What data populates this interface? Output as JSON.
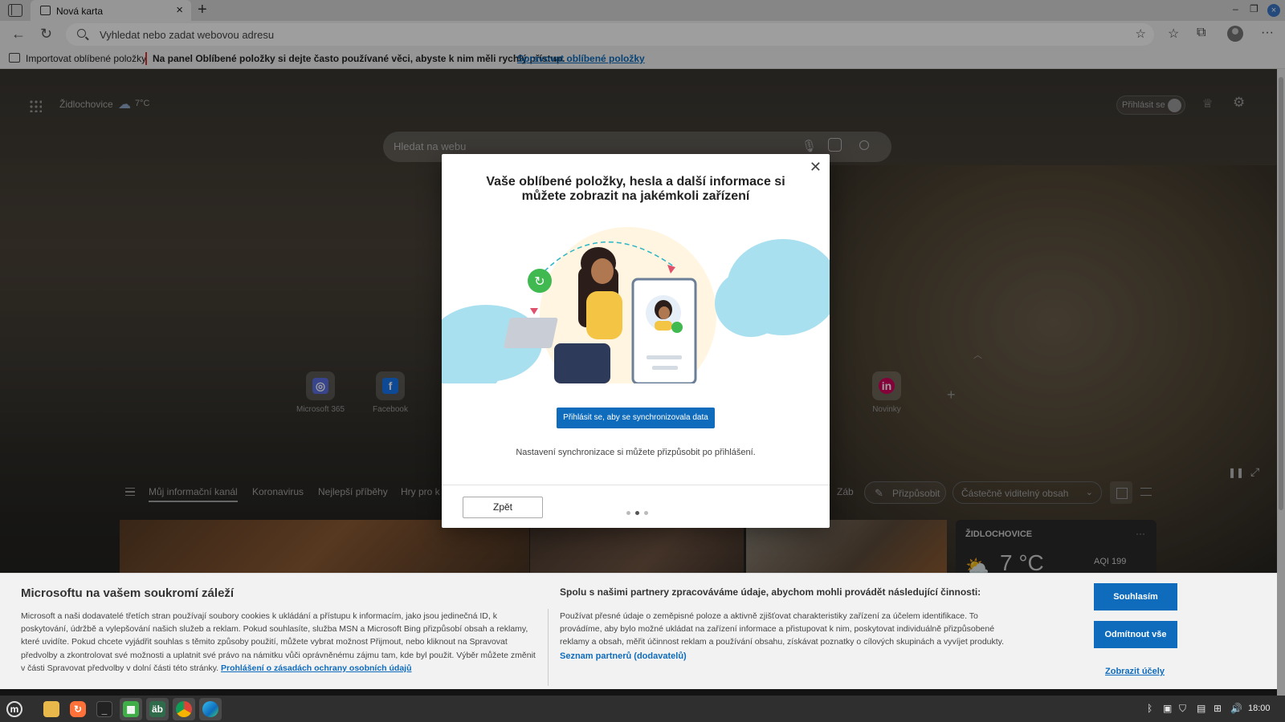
{
  "browser": {
    "tab_title": "Nová karta",
    "address_placeholder": "Vyhledat nebo zadat webovou adresu"
  },
  "favorites_bar": {
    "import_label": "Importovat oblíbené položky",
    "message": "Na panel Oblíbené položky si dejte často používané věci, abyste k nim měli rychlý přístup.",
    "manage_link": "Spravovat oblíbené položky"
  },
  "newtab": {
    "location": "Židlochovice",
    "temperature": "7°C",
    "signin_label": "Přihlásit se",
    "search_placeholder": "Hledat na webu",
    "quick_links": [
      {
        "label": "Microsoft 365",
        "icon": "microsoft365-icon",
        "color": "#5b6ee1"
      },
      {
        "label": "Facebook",
        "icon": "facebook-icon",
        "color": "#1877f2"
      },
      {
        "label": "Novinky",
        "icon": "novinky-icon",
        "color": "#d6005c"
      }
    ],
    "feed_tabs": [
      "Můj informační kanál",
      "Koronavirus",
      "Nejlepší příběhy",
      "Hry pro k",
      "Záb"
    ],
    "customize_label": "Přizpůsobit",
    "content_select_value": "Částečně viditelný obsah",
    "weather_card": {
      "title": "ŽIDLOCHOVICE",
      "temp": "7 °C",
      "aqi": "AQI 199"
    }
  },
  "dialog": {
    "title": "Vaše oblíbené položky, hesla a další informace si můžete zobrazit na jakémkoli zařízení",
    "sync_button": "Přihlásit se, aby se synchronizovala data",
    "subtitle": "Nastavení synchronizace si můžete přizpůsobit po přihlášení.",
    "back_button": "Zpět"
  },
  "consent": {
    "title": "Microsoftu na vašem soukromí záleží",
    "text": "Microsoft a naši dodavatelé třetích stran používají soubory cookies k ukládání a přístupu k informacím, jako jsou jedinečná ID, k poskytování, údržbě a vylepšování našich služeb a reklam. Pokud souhlasíte, služba MSN a Microsoft Bing přizpůsobí obsah a reklamy, které uvidíte. Pokud chcete vyjádřit souhlas s těmito způsoby použití, můžete vybrat možnost Přijmout, nebo kliknout na Spravovat předvolby a zkontrolovat své možnosti a uplatnit své právo na námitku vůči oprávněnému zájmu tam, kde byl použit. Výběr můžete změnit v části Spravovat předvolby v dolní části této stránky.",
    "privacy_link": "Prohlášení o zásadách ochrany osobních údajů",
    "right_title": "Spolu s našimi partnery zpracováváme údaje, abychom mohli provádět následující činnosti:",
    "right_text": "Používat přesné údaje o zeměpisné poloze a aktivně zjišťovat charakteristiky zařízení za účelem identifikace. To provádíme, aby bylo možné ukládat na zařízení informace a přistupovat k nim, poskytovat individuálně přizpůsobené reklamy a obsah, měřit účinnost reklam a používání obsahu, získávat poznatky o cílových skupinách a vyvíjet produkty.",
    "partners_link": "Seznam partnerů (dodavatelů)",
    "accept": "Souhlasím",
    "reject": "Odmítnout vše",
    "purposes": "Zobrazit účely"
  },
  "taskbar": {
    "apps": [
      "menu-icon",
      "files-icon",
      "firefox-icon",
      "terminal-icon",
      "spreadsheet-icon",
      "character-map-icon",
      "chrome-icon",
      "edge-icon"
    ],
    "time": "18:00"
  }
}
